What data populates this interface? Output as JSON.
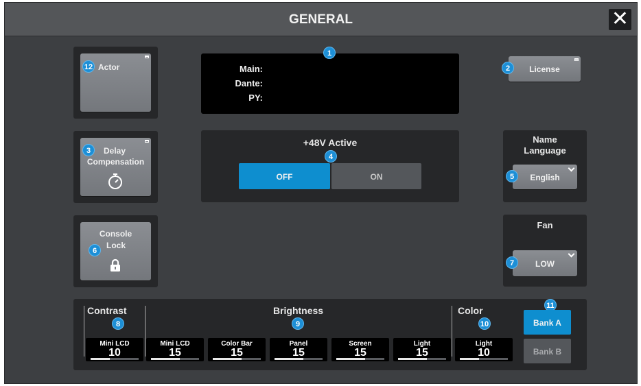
{
  "window": {
    "title": "GENERAL",
    "close_label": "✕"
  },
  "actor": {
    "label": "Actor",
    "badge": "12"
  },
  "version": {
    "badge": "1",
    "main_label": "Main:",
    "dante_label": "Dante:",
    "py_label": "PY:"
  },
  "license": {
    "label": "License",
    "badge": "2"
  },
  "delay": {
    "label_line1": "Delay",
    "label_line2": "Compensation",
    "badge": "3"
  },
  "phantom": {
    "title": "+48V Active",
    "badge": "4",
    "off_label": "OFF",
    "on_label": "ON",
    "selected": "OFF",
    "accent": "#0e8ecf"
  },
  "name_language": {
    "title_line1": "Name",
    "title_line2": "Language",
    "value": "English",
    "badge": "5"
  },
  "console_lock": {
    "label_line1": "Console",
    "label_line2": "Lock",
    "badge": "6"
  },
  "fan": {
    "title": "Fan",
    "value": "LOW",
    "badge": "7"
  },
  "contrast": {
    "title": "Contrast",
    "badge": "8",
    "items": [
      {
        "name": "Mini LCD",
        "value": "10",
        "level": 0.4
      }
    ]
  },
  "brightness": {
    "title": "Brightness",
    "badge": "9",
    "items": [
      {
        "name": "Mini LCD",
        "value": "15",
        "level": 0.6
      },
      {
        "name": "Color Bar",
        "value": "15",
        "level": 0.6
      },
      {
        "name": "Panel",
        "value": "15",
        "level": 0.6
      },
      {
        "name": "Screen",
        "value": "15",
        "level": 0.6
      },
      {
        "name": "Light",
        "value": "15",
        "level": 0.6
      }
    ]
  },
  "color": {
    "title": "Color",
    "badge": "10",
    "items": [
      {
        "name": "Light",
        "value": "10",
        "level": 0.4
      }
    ]
  },
  "bank": {
    "badge": "11",
    "bank_a": "Bank A",
    "bank_b": "Bank B",
    "selected": "Bank A"
  }
}
